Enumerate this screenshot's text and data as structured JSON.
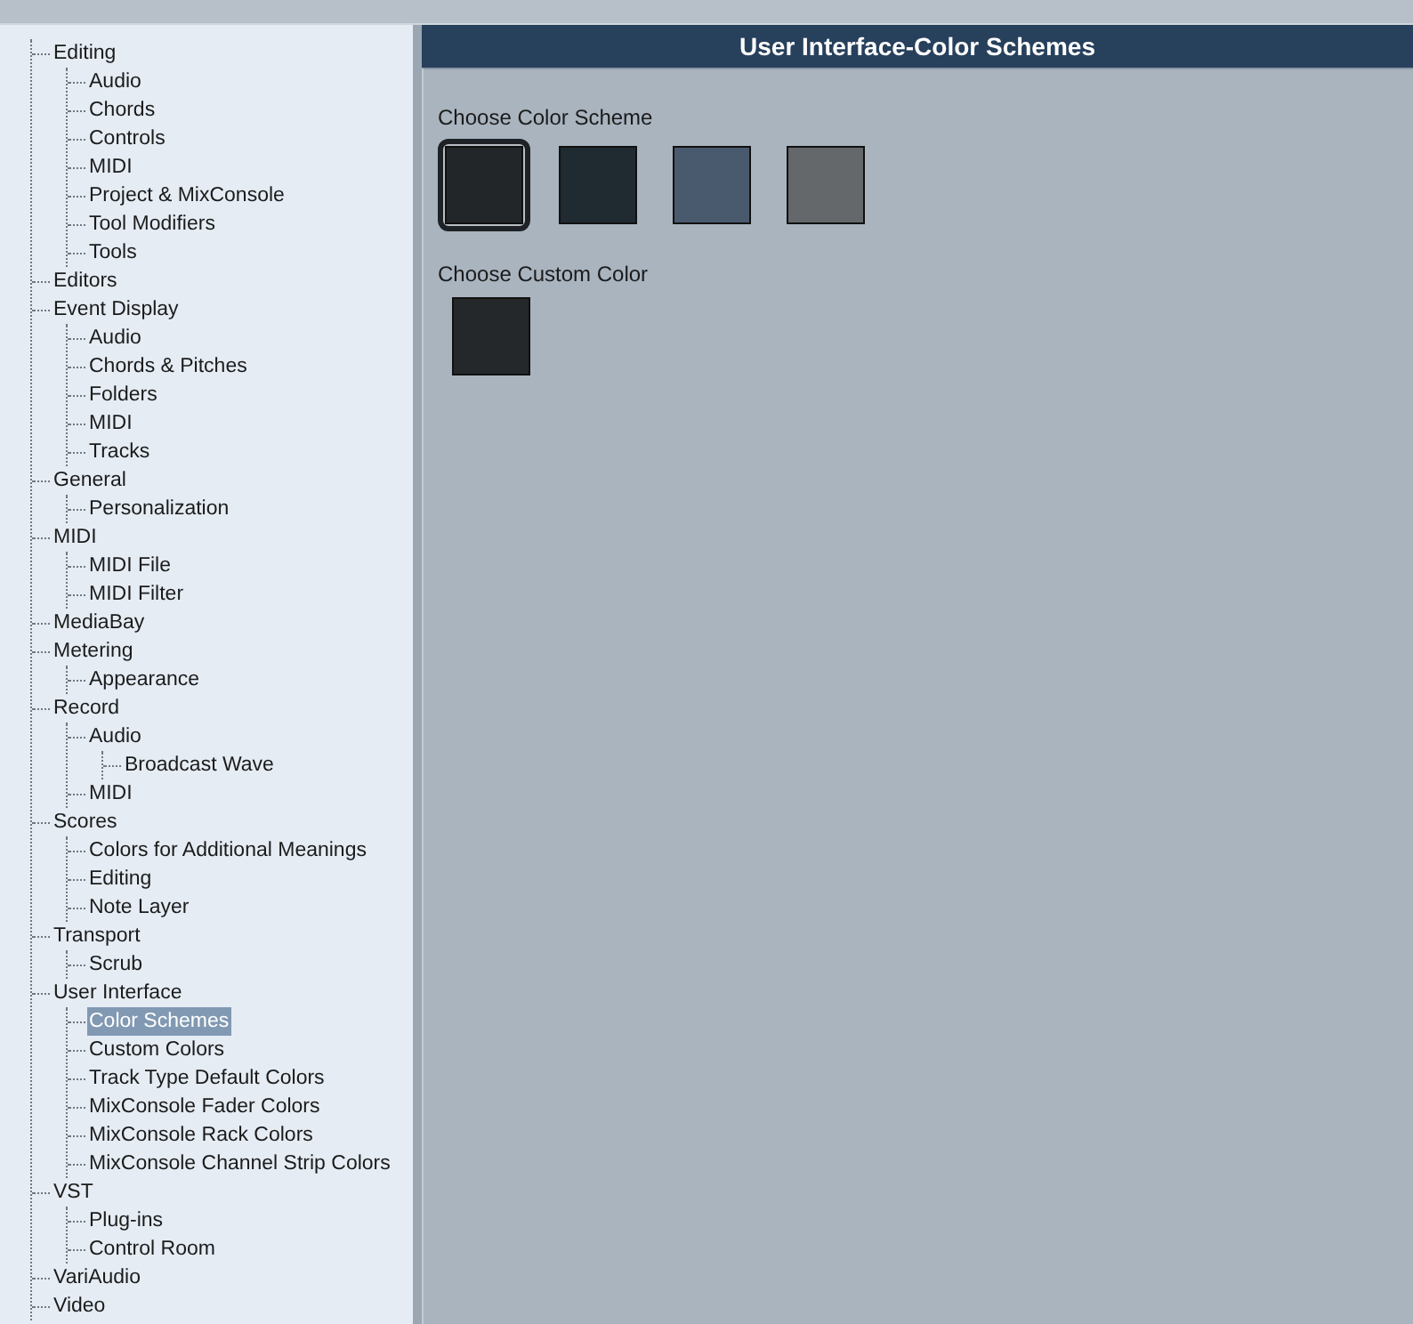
{
  "tree": [
    {
      "label": "Editing",
      "selected": false,
      "children": [
        {
          "label": "Audio",
          "selected": false
        },
        {
          "label": "Chords",
          "selected": false
        },
        {
          "label": "Controls",
          "selected": false
        },
        {
          "label": "MIDI",
          "selected": false
        },
        {
          "label": "Project & MixConsole",
          "selected": false
        },
        {
          "label": "Tool Modifiers",
          "selected": false
        },
        {
          "label": "Tools",
          "selected": false
        }
      ]
    },
    {
      "label": "Editors",
      "selected": false
    },
    {
      "label": "Event Display",
      "selected": false,
      "children": [
        {
          "label": "Audio",
          "selected": false
        },
        {
          "label": "Chords & Pitches",
          "selected": false
        },
        {
          "label": "Folders",
          "selected": false
        },
        {
          "label": "MIDI",
          "selected": false
        },
        {
          "label": "Tracks",
          "selected": false
        }
      ]
    },
    {
      "label": "General",
      "selected": false,
      "children": [
        {
          "label": "Personalization",
          "selected": false
        }
      ]
    },
    {
      "label": "MIDI",
      "selected": false,
      "children": [
        {
          "label": "MIDI File",
          "selected": false
        },
        {
          "label": "MIDI Filter",
          "selected": false
        }
      ]
    },
    {
      "label": "MediaBay",
      "selected": false
    },
    {
      "label": "Metering",
      "selected": false,
      "children": [
        {
          "label": "Appearance",
          "selected": false
        }
      ]
    },
    {
      "label": "Record",
      "selected": false,
      "children": [
        {
          "label": "Audio",
          "selected": false,
          "children": [
            {
              "label": "Broadcast Wave",
              "selected": false
            }
          ]
        },
        {
          "label": "MIDI",
          "selected": false
        }
      ]
    },
    {
      "label": "Scores",
      "selected": false,
      "children": [
        {
          "label": "Colors for Additional Meanings",
          "selected": false
        },
        {
          "label": "Editing",
          "selected": false
        },
        {
          "label": "Note Layer",
          "selected": false
        }
      ]
    },
    {
      "label": "Transport",
      "selected": false,
      "children": [
        {
          "label": "Scrub",
          "selected": false
        }
      ]
    },
    {
      "label": "User Interface",
      "selected": false,
      "children": [
        {
          "label": "Color Schemes",
          "selected": true
        },
        {
          "label": "Custom Colors",
          "selected": false
        },
        {
          "label": "Track Type Default Colors",
          "selected": false
        },
        {
          "label": "MixConsole Fader Colors",
          "selected": false
        },
        {
          "label": "MixConsole Rack Colors",
          "selected": false
        },
        {
          "label": "MixConsole Channel Strip Colors",
          "selected": false
        }
      ]
    },
    {
      "label": "VST",
      "selected": false,
      "children": [
        {
          "label": "Plug-ins",
          "selected": false
        },
        {
          "label": "Control Room",
          "selected": false
        }
      ]
    },
    {
      "label": "VariAudio",
      "selected": false
    },
    {
      "label": "Video",
      "selected": false
    }
  ],
  "panel": {
    "title": "User Interface-Color Schemes",
    "scheme_label": "Choose Color Scheme",
    "schemes": [
      {
        "color": "#232629",
        "selected": true
      },
      {
        "color": "#1f2a31",
        "selected": false
      },
      {
        "color": "#4a5a6e",
        "selected": false
      },
      {
        "color": "#64686b",
        "selected": false
      }
    ],
    "custom_label": "Choose Custom Color",
    "custom_color": {
      "color": "#25282b"
    }
  }
}
